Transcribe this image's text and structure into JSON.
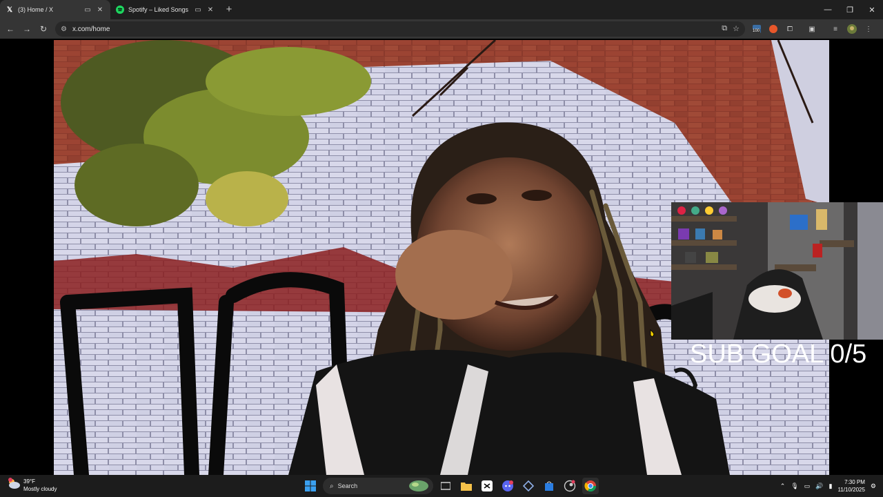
{
  "browser": {
    "tabs": [
      {
        "title": "(3) Home / X",
        "favicon": "x-logo-icon",
        "active": true
      },
      {
        "title": "Spotify – Liked Songs",
        "favicon": "spotify-logo-icon",
        "active": false
      }
    ],
    "url": "x.com/home",
    "extension_badge": "100"
  },
  "stream": {
    "overlay_text": "SUB GOAL 0/5"
  },
  "taskbar": {
    "weather_temp": "39°F",
    "weather_desc": "Mostly cloudy",
    "search_placeholder": "Search",
    "time": "7:30 PM",
    "date": "11/10/2025"
  },
  "colors": {
    "tab_bar": "#1f1f1f",
    "toolbar": "#353535",
    "taskbar": "#1c1c1c",
    "spotify_green": "#1ed760"
  }
}
